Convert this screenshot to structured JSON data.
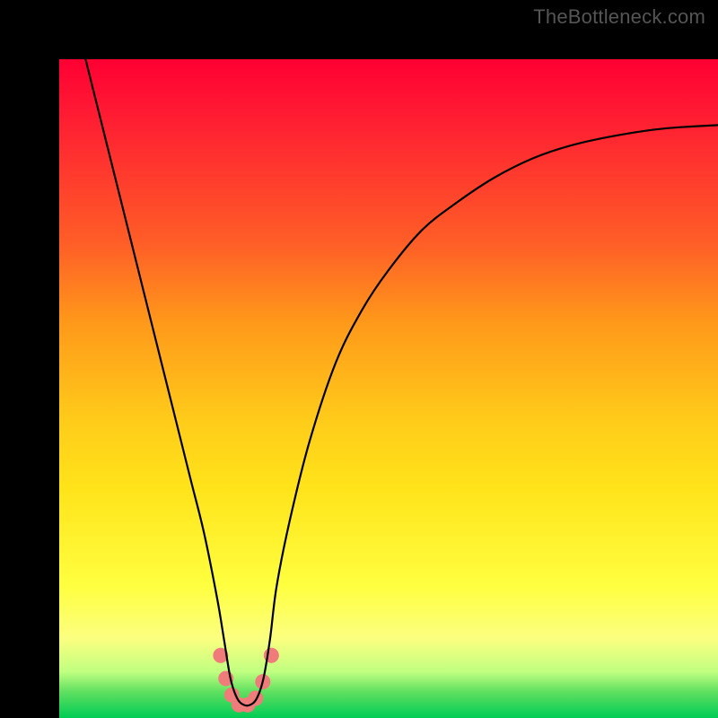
{
  "watermark": "TheBottleneck.com",
  "chart_data": {
    "type": "line",
    "title": "",
    "xlabel": "",
    "ylabel": "",
    "xlim": [
      0,
      100
    ],
    "ylim": [
      0,
      100
    ],
    "background": "rainbow-vertical",
    "main_curve": {
      "name": "bottleneck-curve",
      "color": "#000000",
      "x": [
        4,
        6,
        8,
        10,
        12,
        14,
        16,
        18,
        20,
        22,
        24,
        25,
        26,
        27,
        28,
        29,
        30,
        31,
        32,
        33,
        35,
        38,
        42,
        46,
        50,
        55,
        60,
        66,
        72,
        78,
        85,
        92,
        100
      ],
      "y": [
        100,
        92,
        84,
        76,
        68,
        60,
        52,
        44,
        36,
        28,
        18,
        12,
        6,
        3,
        2,
        2,
        3,
        6,
        12,
        20,
        30,
        42,
        54,
        62,
        68,
        74,
        78,
        82,
        85,
        87,
        88.5,
        89.5,
        90
      ]
    },
    "marker_series": {
      "name": "optimal-range-markers",
      "color": "#ef7b7b",
      "points": [
        {
          "x": 24.5,
          "y": 9.5
        },
        {
          "x": 25.3,
          "y": 6.0
        },
        {
          "x": 26.2,
          "y": 3.5
        },
        {
          "x": 27.3,
          "y": 2.0
        },
        {
          "x": 28.6,
          "y": 2.0
        },
        {
          "x": 29.8,
          "y": 3.0
        },
        {
          "x": 30.9,
          "y": 5.5
        },
        {
          "x": 32.2,
          "y": 9.5
        }
      ]
    }
  }
}
